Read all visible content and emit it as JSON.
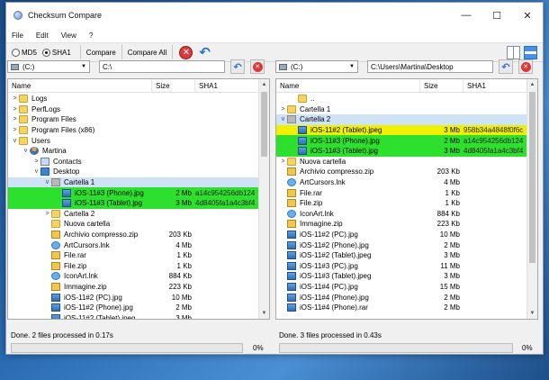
{
  "window": {
    "title": "Checksum Compare"
  },
  "menu": [
    "File",
    "Edit",
    "View",
    "?"
  ],
  "toolbar": {
    "md5": "MD5",
    "sha1": "SHA1",
    "selected": "SHA1",
    "compare": "Compare",
    "compare_all": "Compare All"
  },
  "columns": {
    "name": "Name",
    "size": "Size",
    "sha": "SHA1"
  },
  "left": {
    "drive": "(C:)",
    "path": "C:\\",
    "status": "Done.  2 files processed in 0.17s",
    "progress_percent": 0,
    "progress_label": "0%",
    "rows": [
      {
        "indent": 0,
        "twisty": ">",
        "icon": "folder",
        "name": "Logs",
        "size": "",
        "sha": "",
        "hl": ""
      },
      {
        "indent": 0,
        "twisty": ">",
        "icon": "folder",
        "name": "PerfLogs",
        "size": "",
        "sha": "",
        "hl": ""
      },
      {
        "indent": 0,
        "twisty": ">",
        "icon": "folder",
        "name": "Program Files",
        "size": "",
        "sha": "",
        "hl": ""
      },
      {
        "indent": 0,
        "twisty": ">",
        "icon": "folder",
        "name": "Program Files (x86)",
        "size": "",
        "sha": "",
        "hl": ""
      },
      {
        "indent": 0,
        "twisty": "v",
        "icon": "folder",
        "name": "Users",
        "size": "",
        "sha": "",
        "hl": ""
      },
      {
        "indent": 1,
        "twisty": "v",
        "icon": "user",
        "name": "Martina",
        "size": "",
        "sha": "",
        "hl": ""
      },
      {
        "indent": 2,
        "twisty": ">",
        "icon": "contacts",
        "name": "Contacts",
        "size": "",
        "sha": "",
        "hl": ""
      },
      {
        "indent": 2,
        "twisty": "v",
        "icon": "desk",
        "name": "Desktop",
        "size": "",
        "sha": "",
        "hl": ""
      },
      {
        "indent": 3,
        "twisty": "v",
        "icon": "folderg",
        "name": "Cartella 1",
        "size": "",
        "sha": "",
        "hl": "sel"
      },
      {
        "indent": 4,
        "twisty": "",
        "icon": "img",
        "name": "iOS-11#3 (Phone).jpg",
        "size": "2 Mb",
        "sha": "a14c954256db124",
        "hl": "green"
      },
      {
        "indent": 4,
        "twisty": "",
        "icon": "img",
        "name": "iOS-11#3 (Tablet).jpg",
        "size": "3 Mb",
        "sha": "4d8405fa1a4c3bf4",
        "hl": "green"
      },
      {
        "indent": 3,
        "twisty": ">",
        "icon": "folder",
        "name": "Cartella 2",
        "size": "",
        "sha": "",
        "hl": ""
      },
      {
        "indent": 3,
        "twisty": "",
        "icon": "folder",
        "name": "Nuova cartella",
        "size": "",
        "sha": "",
        "hl": ""
      },
      {
        "indent": 3,
        "twisty": "",
        "icon": "zip",
        "name": "Archivio compresso.zip",
        "size": "203 Kb",
        "sha": "",
        "hl": ""
      },
      {
        "indent": 3,
        "twisty": "",
        "icon": "lnk",
        "name": "ArtCursors.lnk",
        "size": "4 Mb",
        "sha": "",
        "hl": ""
      },
      {
        "indent": 3,
        "twisty": "",
        "icon": "zip",
        "name": "File.rar",
        "size": "1 Kb",
        "sha": "",
        "hl": ""
      },
      {
        "indent": 3,
        "twisty": "",
        "icon": "zip",
        "name": "File.zip",
        "size": "1 Kb",
        "sha": "",
        "hl": ""
      },
      {
        "indent": 3,
        "twisty": "",
        "icon": "lnk",
        "name": "IconArt.lnk",
        "size": "884 Kb",
        "sha": "",
        "hl": ""
      },
      {
        "indent": 3,
        "twisty": "",
        "icon": "zip",
        "name": "Immagine.zip",
        "size": "223 Kb",
        "sha": "",
        "hl": ""
      },
      {
        "indent": 3,
        "twisty": "",
        "icon": "img",
        "name": "iOS-11#2 (PC).jpg",
        "size": "10 Mb",
        "sha": "",
        "hl": ""
      },
      {
        "indent": 3,
        "twisty": "",
        "icon": "img",
        "name": "iOS-11#2 (Phone).jpg",
        "size": "2 Mb",
        "sha": "",
        "hl": ""
      },
      {
        "indent": 3,
        "twisty": "",
        "icon": "img",
        "name": "iOS-11#2 (Tablet).jpeg",
        "size": "3 Mb",
        "sha": "",
        "hl": ""
      }
    ]
  },
  "right": {
    "drive": "(C:)",
    "path": "C:\\Users\\Martina\\Desktop",
    "status": "Done.  3 files processed in 0.43s",
    "progress_percent": 0,
    "progress_label": "0%",
    "rows": [
      {
        "indent": 1,
        "twisty": "",
        "icon": "folder",
        "name": "..",
        "size": "",
        "sha": "",
        "hl": ""
      },
      {
        "indent": 0,
        "twisty": ">",
        "icon": "folder",
        "name": "Cartella 1",
        "size": "",
        "sha": "",
        "hl": ""
      },
      {
        "indent": 0,
        "twisty": "v",
        "icon": "folderg",
        "name": "Cartella 2",
        "size": "",
        "sha": "",
        "hl": "sel"
      },
      {
        "indent": 1,
        "twisty": "",
        "icon": "img",
        "name": "iOS-11#2 (Tablet).jpeg",
        "size": "3 Mb",
        "sha": "958b34a4848f0f6c",
        "hl": "yellow"
      },
      {
        "indent": 1,
        "twisty": "",
        "icon": "img",
        "name": "iOS-11#3 (Phone).jpg",
        "size": "2 Mb",
        "sha": "a14c954256db124",
        "hl": "green"
      },
      {
        "indent": 1,
        "twisty": "",
        "icon": "img",
        "name": "iOS-11#3 (Tablet).jpg",
        "size": "3 Mb",
        "sha": "4d8405fa1a4c3bf4",
        "hl": "green"
      },
      {
        "indent": 0,
        "twisty": ">",
        "icon": "folder",
        "name": "Nuova cartella",
        "size": "",
        "sha": "",
        "hl": ""
      },
      {
        "indent": 0,
        "twisty": "",
        "icon": "zip",
        "name": "Archivio compresso.zip",
        "size": "203 Kb",
        "sha": "",
        "hl": ""
      },
      {
        "indent": 0,
        "twisty": "",
        "icon": "lnk",
        "name": "ArtCursors.lnk",
        "size": "4 Mb",
        "sha": "",
        "hl": ""
      },
      {
        "indent": 0,
        "twisty": "",
        "icon": "zip",
        "name": "File.rar",
        "size": "1 Kb",
        "sha": "",
        "hl": ""
      },
      {
        "indent": 0,
        "twisty": "",
        "icon": "zip",
        "name": "File.zip",
        "size": "1 Kb",
        "sha": "",
        "hl": ""
      },
      {
        "indent": 0,
        "twisty": "",
        "icon": "lnk",
        "name": "IconArt.lnk",
        "size": "884 Kb",
        "sha": "",
        "hl": ""
      },
      {
        "indent": 0,
        "twisty": "",
        "icon": "zip",
        "name": "Immagine.zip",
        "size": "223 Kb",
        "sha": "",
        "hl": ""
      },
      {
        "indent": 0,
        "twisty": "",
        "icon": "img",
        "name": "iOS-11#2 (PC).jpg",
        "size": "10 Mb",
        "sha": "",
        "hl": ""
      },
      {
        "indent": 0,
        "twisty": "",
        "icon": "img",
        "name": "iOS-11#2 (Phone).jpg",
        "size": "2 Mb",
        "sha": "",
        "hl": ""
      },
      {
        "indent": 0,
        "twisty": "",
        "icon": "img",
        "name": "iOS-11#2 (Tablet).jpeg",
        "size": "3 Mb",
        "sha": "",
        "hl": ""
      },
      {
        "indent": 0,
        "twisty": "",
        "icon": "img",
        "name": "iOS-11#3 (PC).jpg",
        "size": "11 Mb",
        "sha": "",
        "hl": ""
      },
      {
        "indent": 0,
        "twisty": "",
        "icon": "img",
        "name": "iOS-11#3 (Tablet).jpeg",
        "size": "3 Mb",
        "sha": "",
        "hl": ""
      },
      {
        "indent": 0,
        "twisty": "",
        "icon": "img",
        "name": "iOS-11#4 (PC).jpg",
        "size": "15 Mb",
        "sha": "",
        "hl": ""
      },
      {
        "indent": 0,
        "twisty": "",
        "icon": "img",
        "name": "iOS-11#4 (Phone).jpg",
        "size": "2 Mb",
        "sha": "",
        "hl": ""
      },
      {
        "indent": 0,
        "twisty": "",
        "icon": "img",
        "name": "iOS-11#4 (Phone).rar",
        "size": "2 Mb",
        "sha": "",
        "hl": ""
      }
    ]
  }
}
